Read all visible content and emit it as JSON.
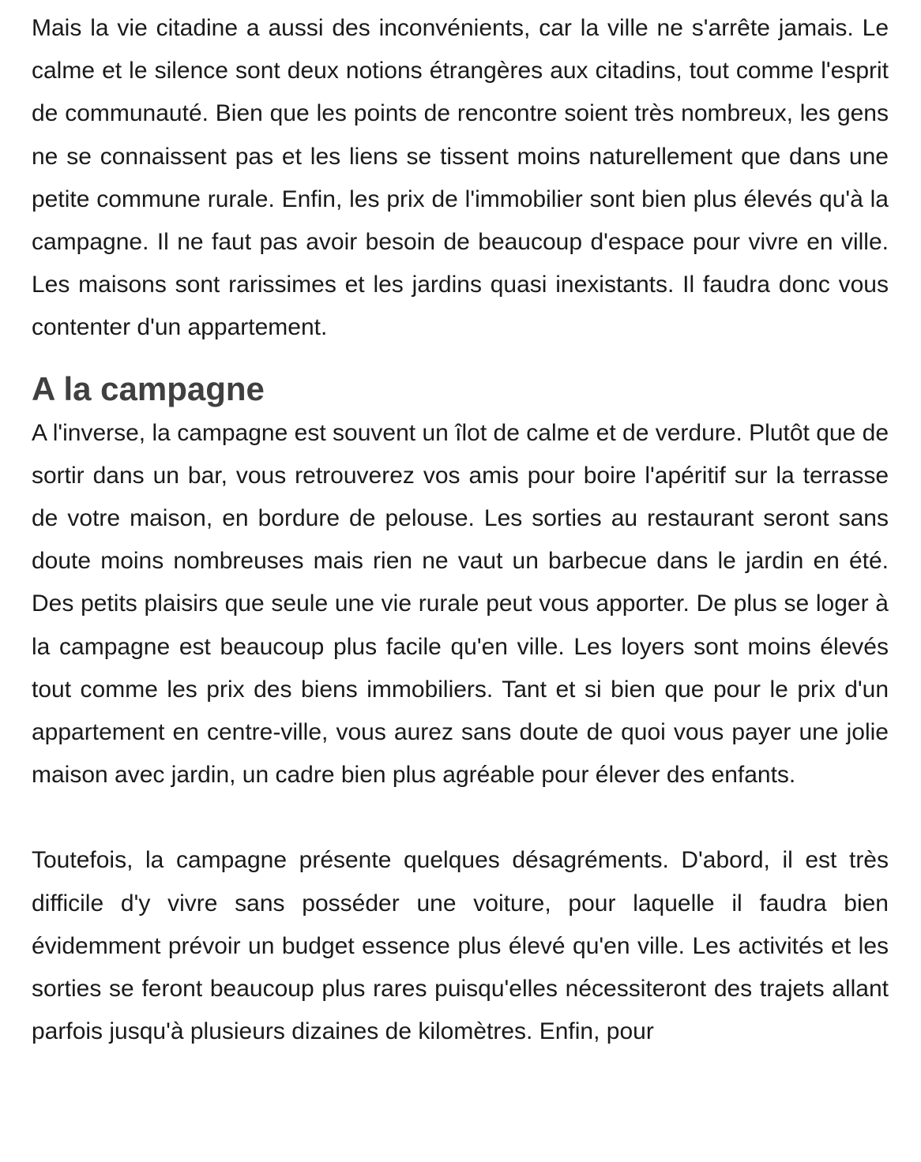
{
  "article": {
    "paragraph_1": "Mais la vie citadine a aussi des inconvénients, car la ville ne s'arrête jamais. Le calme et le silence sont deux notions étrangères aux citadins, tout comme l'esprit de communauté. Bien que les points de rencontre soient très nombreux, les gens ne se connaissent pas et les liens se tissent moins naturellement que dans une petite commune rurale. Enfin, les prix de l'immobilier sont bien plus élevés qu'à la campagne. Il ne faut pas avoir besoin de beaucoup d'espace pour vivre en ville. Les maisons sont rarissimes et les jardins quasi inexistants. Il faudra donc vous contenter d'un appartement.",
    "heading_campagne": "A la campagne",
    "paragraph_2": "A l'inverse, la campagne est souvent un îlot de calme et de verdure. Plutôt que de sortir dans un bar, vous retrouverez vos amis pour boire l'apéritif sur la terrasse de votre maison, en bordure de pelouse. Les sorties au restaurant seront sans doute moins nombreuses mais rien ne vaut un barbecue dans le jardin en été. Des petits plaisirs que seule une vie rurale peut vous apporter. De plus se loger à la campagne est beaucoup plus facile qu'en ville. Les loyers sont moins élevés tout comme les prix des biens immobiliers. Tant et si bien que pour le prix d'un appartement en centre-ville, vous aurez sans doute de quoi vous payer une jolie maison avec jardin, un cadre bien plus agréable pour élever des enfants.",
    "paragraph_3": "Toutefois, la campagne présente quelques désagréments. D'abord, il est très difficile d'y vivre sans posséder une voiture, pour laquelle il faudra bien évidemment prévoir un budget essence plus élevé qu'en ville. Les activités et les sorties se feront beaucoup plus rares puisqu'elles nécessiteront des trajets allant parfois jusqu'à plusieurs dizaines de kilomètres. Enfin, pour"
  }
}
